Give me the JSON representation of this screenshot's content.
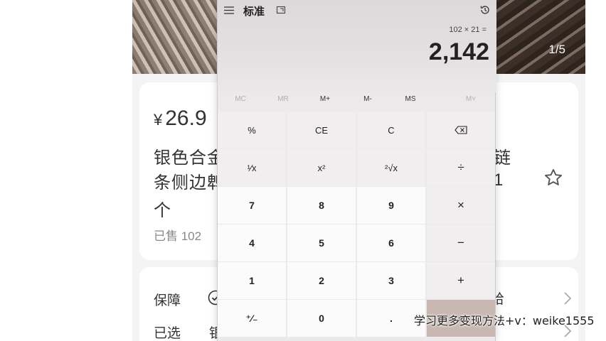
{
  "background": {
    "image_counter": "1/5",
    "price_symbol": "¥",
    "price": "26.9",
    "title_line1": "银色合金",
    "title_line2": "条侧边鹎",
    "title_line3": "个",
    "title_tail1": "链",
    "title_tail2": "1",
    "sold": "已售 102",
    "guarantee_label": "保障",
    "guarantee_tail": "给",
    "selected_label": "已选",
    "selected_value": "银"
  },
  "calculator": {
    "mode": "标准",
    "expression": "102 × 21 =",
    "result": "2,142",
    "memory": [
      {
        "label": "MC",
        "enabled": false
      },
      {
        "label": "MR",
        "enabled": false
      },
      {
        "label": "M+",
        "enabled": true
      },
      {
        "label": "M-",
        "enabled": true
      },
      {
        "label": "MS",
        "enabled": true
      },
      {
        "label": "M˅",
        "enabled": false
      }
    ],
    "keys": {
      "percent": "%",
      "ce": "CE",
      "c": "C",
      "backspace": "⌫",
      "reciprocal": "¹⁄x",
      "square": "x²",
      "sqrt": "²√x",
      "divide": "÷",
      "seven": "7",
      "eight": "8",
      "nine": "9",
      "multiply": "×",
      "four": "4",
      "five": "5",
      "six": "6",
      "minus": "−",
      "one": "1",
      "two": "2",
      "three": "3",
      "plus": "+",
      "negate": "⁺⁄₋",
      "zero": "0",
      "decimal": ".",
      "equals": "="
    }
  },
  "watermark": "学习更多变现方法+v：weike1555"
}
